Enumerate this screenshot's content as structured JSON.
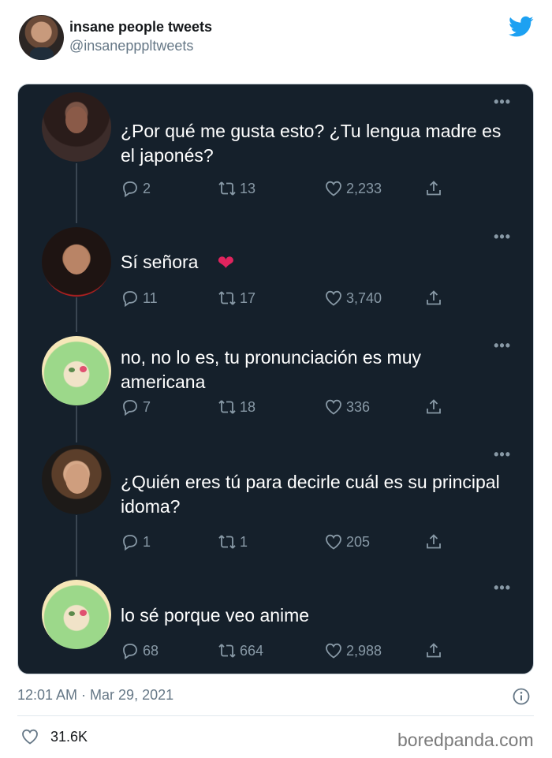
{
  "outer_tweet": {
    "name": "insane people tweets",
    "handle": "@insanepppltweets",
    "timestamp": "12:01 AM · Mar 29, 2021",
    "likes": "31.6K",
    "colors": {
      "twitter_blue": "#1da1f2",
      "dark_bg": "#15202b",
      "muted": "#8899a6"
    }
  },
  "thread": [
    {
      "text": "¿Por qué me gusta esto? ¿Tu lengua madre es el japonés?",
      "emoji": "",
      "replies": "2",
      "retweets": "13",
      "likes": "2,233"
    },
    {
      "text": "Sí señora",
      "emoji": "❤",
      "replies": "11",
      "retweets": "17",
      "likes": "3,740"
    },
    {
      "text": "no, no lo es, tu pronunciación es muy americana",
      "emoji": "",
      "replies": "7",
      "retweets": "18",
      "likes": "336"
    },
    {
      "text": "¿Quién eres tú para decirle cuál es su principal idoma?",
      "emoji": "",
      "replies": "1",
      "retweets": "1",
      "likes": "205"
    },
    {
      "text": "lo sé porque veo anime",
      "emoji": "",
      "replies": "68",
      "retweets": "664",
      "likes": "2,988"
    }
  ],
  "more_label": "•••",
  "watermark": "boredpanda.com",
  "icons": [
    "twitter-bird-icon",
    "reply-icon",
    "retweet-icon",
    "like-icon",
    "share-icon",
    "more-icon",
    "info-icon",
    "heart-icon"
  ]
}
